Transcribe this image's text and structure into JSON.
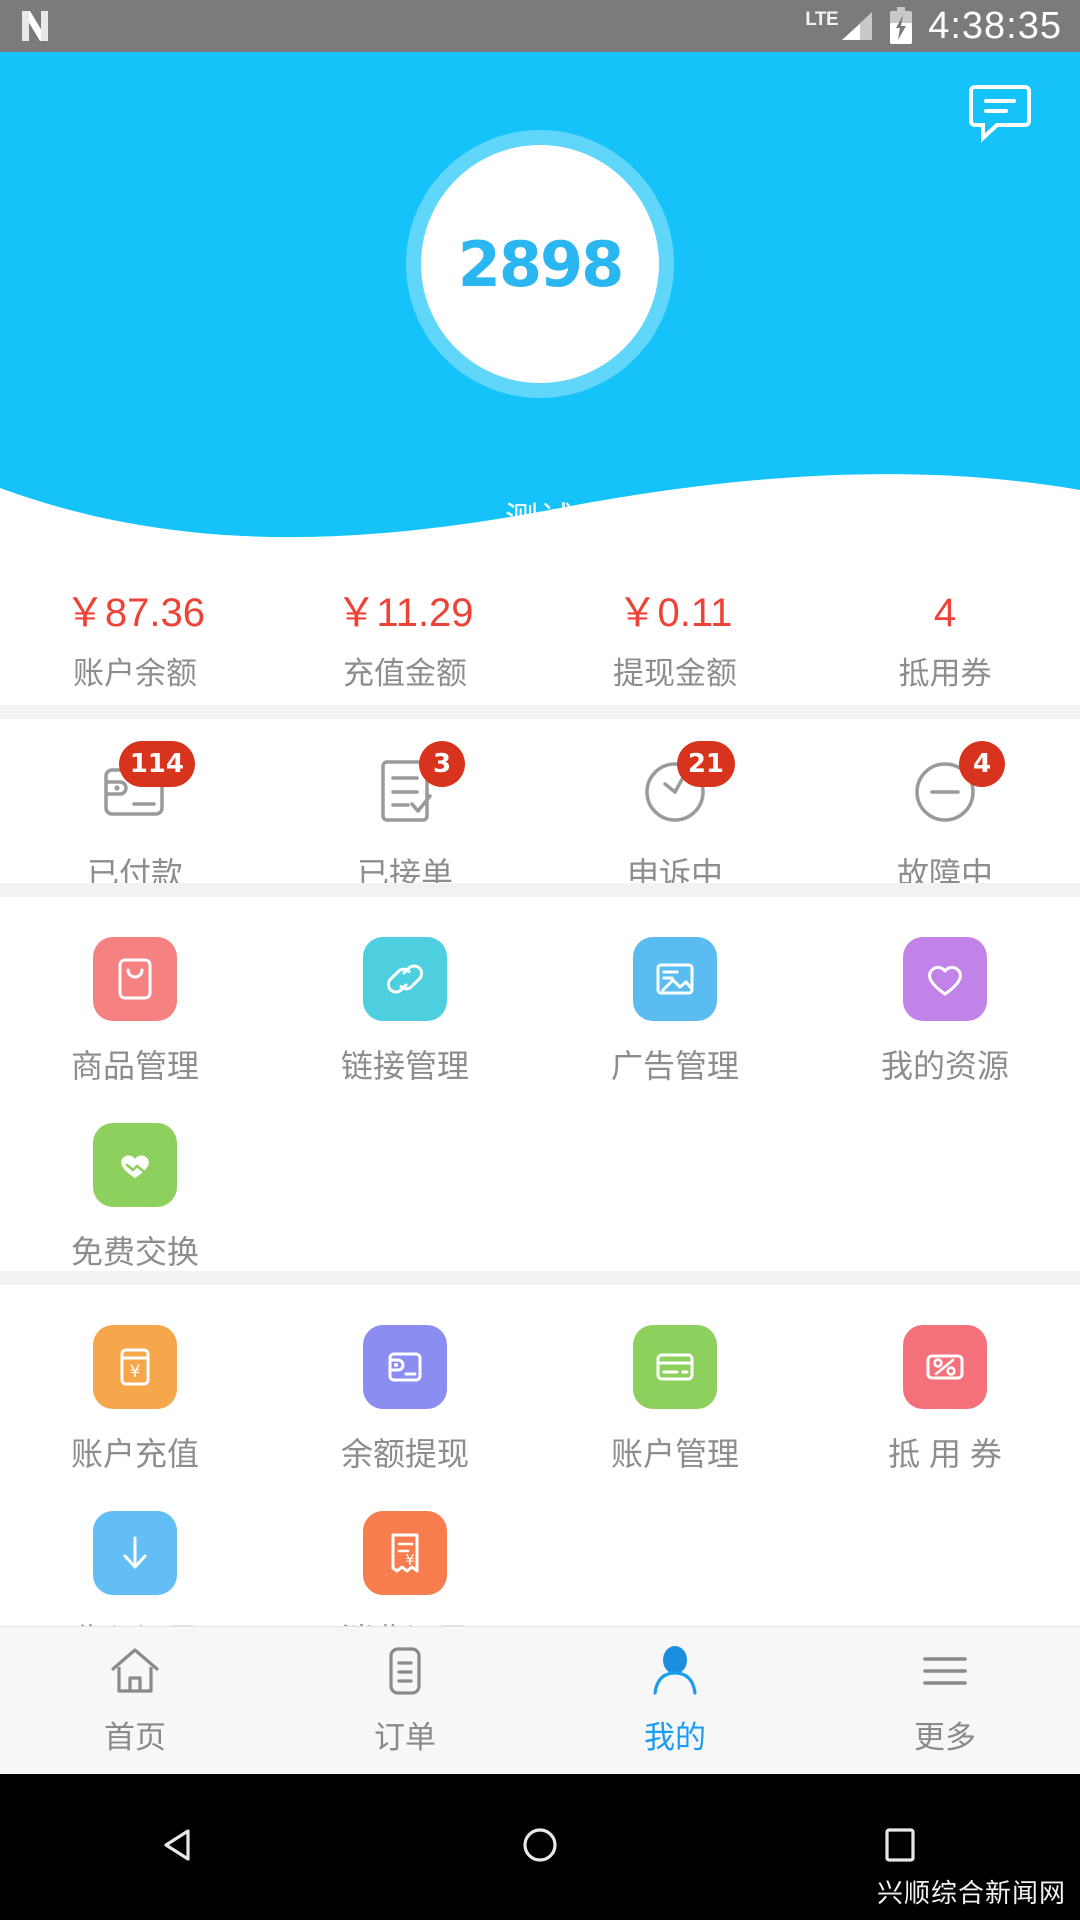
{
  "status_bar": {
    "app_icon": "netflix-n-icon",
    "network_type": "LTE",
    "signal_icon": "signal-bars-icon",
    "battery_icon": "battery-charging-icon",
    "time": "4:38:35"
  },
  "header": {
    "message_icon": "message-bubble-icon",
    "avatar_text": "2898",
    "username": "测试",
    "bg_color": "#15c3fa"
  },
  "stats": {
    "items": [
      {
        "value": "￥87.36",
        "label": "账户余额"
      },
      {
        "value": "￥11.29",
        "label": "充值金额"
      },
      {
        "value": "￥0.11",
        "label": "提现金额"
      },
      {
        "value": "4",
        "label": "抵用券"
      }
    ],
    "value_color": "#ef4236"
  },
  "orders": {
    "items": [
      {
        "label": "已付款",
        "badge": "114",
        "icon": "wallet-icon"
      },
      {
        "label": "已接单",
        "badge": "3",
        "icon": "checklist-icon"
      },
      {
        "label": "申诉中",
        "badge": "21",
        "icon": "clock-icon"
      },
      {
        "label": "故障中",
        "badge": "4",
        "icon": "minus-circle-icon"
      }
    ],
    "badge_color": "#d8341d"
  },
  "sections": [
    {
      "name": "management",
      "tiles": [
        {
          "label": "商品管理",
          "icon": "shopping-bag-icon",
          "color": "#f58181"
        },
        {
          "label": "链接管理",
          "icon": "link-icon",
          "color": "#4ecfe0"
        },
        {
          "label": "广告管理",
          "icon": "image-icon",
          "color": "#5bbcf2"
        },
        {
          "label": "我的资源",
          "icon": "heart-icon",
          "color": "#c183e8"
        },
        {
          "label": "免费交换",
          "icon": "handshake-icon",
          "color": "#8ed05e"
        }
      ]
    },
    {
      "name": "finance",
      "tiles": [
        {
          "label": "账户充值",
          "icon": "yen-card-icon",
          "color": "#f7a council"
        },
        {
          "label": "余额提现",
          "icon": "wallet-out-icon",
          "color": "#8b8ef0"
        },
        {
          "label": "账户管理",
          "icon": "credit-card-icon",
          "color": "#8ed05e"
        },
        {
          "label": "抵 用 券",
          "icon": "coupon-icon",
          "color": "#f4707a"
        },
        {
          "label": "收入记录",
          "icon": "arrow-down-icon",
          "color": "#62bef5"
        },
        {
          "label": "消费记录",
          "icon": "receipt-yen-icon",
          "color": "#f87d4e"
        }
      ]
    }
  ],
  "tabbar": {
    "items": [
      {
        "label": "首页",
        "icon": "home-icon",
        "active": false
      },
      {
        "label": "订单",
        "icon": "orders-icon",
        "active": false
      },
      {
        "label": "我的",
        "icon": "person-icon",
        "active": true
      },
      {
        "label": "更多",
        "icon": "menu-icon",
        "active": false
      }
    ],
    "active_color": "#1b9df0",
    "inactive_color": "#8a8a8a"
  },
  "android_nav": {
    "back_icon": "triangle-back-icon",
    "home_icon": "circle-home-icon",
    "recents_icon": "square-recents-icon"
  },
  "watermark": "兴顺综合新闻网"
}
